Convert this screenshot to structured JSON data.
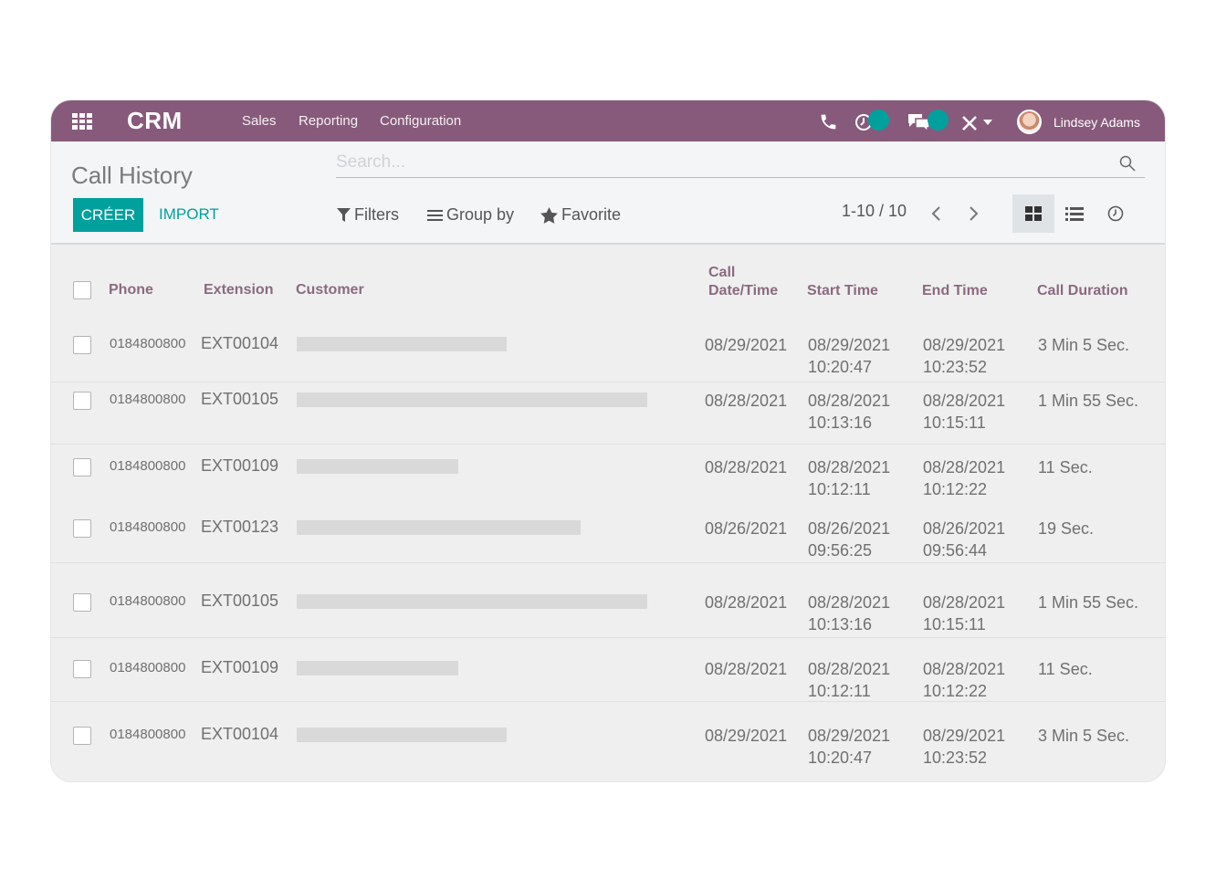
{
  "navbar": {
    "app_name": "CRM",
    "menu": [
      "Sales",
      "Reporting",
      "Configuration"
    ],
    "user_name": "Lindsey Adams",
    "accent_color": "#875a7b",
    "badge_color": "#00a09d"
  },
  "control_panel": {
    "title": "Call History",
    "create_label": "CRÉER",
    "import_label": "IMPORT",
    "search_placeholder": "Search...",
    "filters_label": "Filters",
    "group_by_label": "Group by",
    "favorite_label": "Favorite",
    "pager": "1-10 / 10"
  },
  "table": {
    "columns": {
      "phone": "Phone",
      "extension": "Extension",
      "customer": "Customer",
      "call_datetime_1": "Call",
      "call_datetime_2": "Date/Time",
      "start_time": "Start Time",
      "end_time": "End Time",
      "duration": "Call Duration"
    },
    "rows": [
      {
        "phone": "0184800800",
        "extension": "EXT00104",
        "customer_bar": 0.6,
        "date": "08/29/2021",
        "start_date": "08/29/2021",
        "start_time": "10:20:47",
        "end_date": "08/29/2021",
        "end_time": "10:23:52",
        "duration": "3 Min 5 Sec."
      },
      {
        "phone": "0184800800",
        "extension": "EXT00105",
        "customer_bar": 1.0,
        "date": "08/28/2021",
        "start_date": "08/28/2021",
        "start_time": "10:13:16",
        "end_date": "08/28/2021",
        "end_time": "10:15:11",
        "duration": "1 Min 55 Sec."
      },
      {
        "phone": "0184800800",
        "extension": "EXT00109",
        "customer_bar": 0.46,
        "date": "08/28/2021",
        "start_date": "08/28/2021",
        "start_time": "10:12:11",
        "end_date": "08/28/2021",
        "end_time": "10:12:22",
        "duration": "11 Sec."
      },
      {
        "phone": "0184800800",
        "extension": "EXT00123",
        "customer_bar": 0.81,
        "date": "08/26/2021",
        "start_date": "08/26/2021",
        "start_time": "09:56:25",
        "end_date": "08/26/2021",
        "end_time": "09:56:44",
        "duration": "19 Sec."
      },
      {
        "phone": "0184800800",
        "extension": "EXT00105",
        "customer_bar": 1.0,
        "date": "08/28/2021",
        "start_date": "08/28/2021",
        "start_time": "10:13:16",
        "end_date": "08/28/2021",
        "end_time": "10:15:11",
        "duration": "1 Min 55 Sec."
      },
      {
        "phone": "0184800800",
        "extension": "EXT00109",
        "customer_bar": 0.46,
        "date": "08/28/2021",
        "start_date": "08/28/2021",
        "start_time": "10:12:11",
        "end_date": "08/28/2021",
        "end_time": "10:12:22",
        "duration": "11 Sec."
      },
      {
        "phone": "0184800800",
        "extension": "EXT00104",
        "customer_bar": 0.6,
        "date": "08/29/2021",
        "start_date": "08/29/2021",
        "start_time": "10:20:47",
        "end_date": "08/29/2021",
        "end_time": "10:23:52",
        "duration": "3 Min 5 Sec."
      }
    ]
  }
}
